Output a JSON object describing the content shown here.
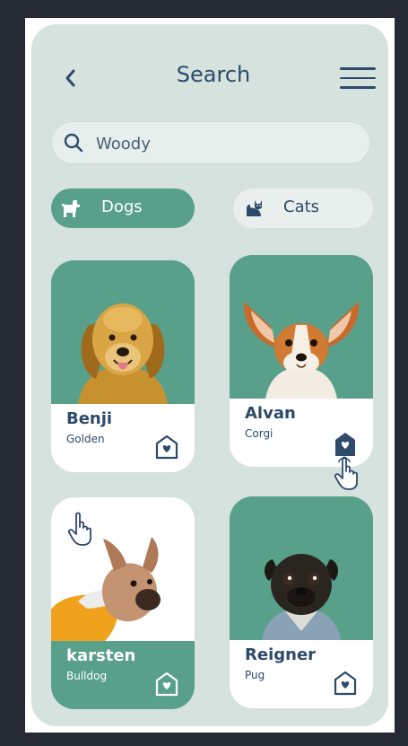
{
  "header": {
    "title": "Search",
    "back_icon": "chevron-left-icon",
    "menu_icon": "hamburger-menu-icon"
  },
  "search": {
    "value": "Woody",
    "icon": "search-icon"
  },
  "tabs": [
    {
      "label": "Dogs",
      "icon": "dog-icon",
      "active": true
    },
    {
      "label": "Cats",
      "icon": "cat-icon",
      "active": false
    }
  ],
  "pets": [
    {
      "name": "Benji",
      "breed": "Golden"
    },
    {
      "name": "Alvan",
      "breed": "Corgi"
    },
    {
      "name": "karsten",
      "breed": "Bulldog"
    },
    {
      "name": "Reigner",
      "breed": "Pug"
    }
  ],
  "colors": {
    "accent": "#58a08a",
    "text": "#2d4a6b",
    "background": "#d5e2de"
  }
}
